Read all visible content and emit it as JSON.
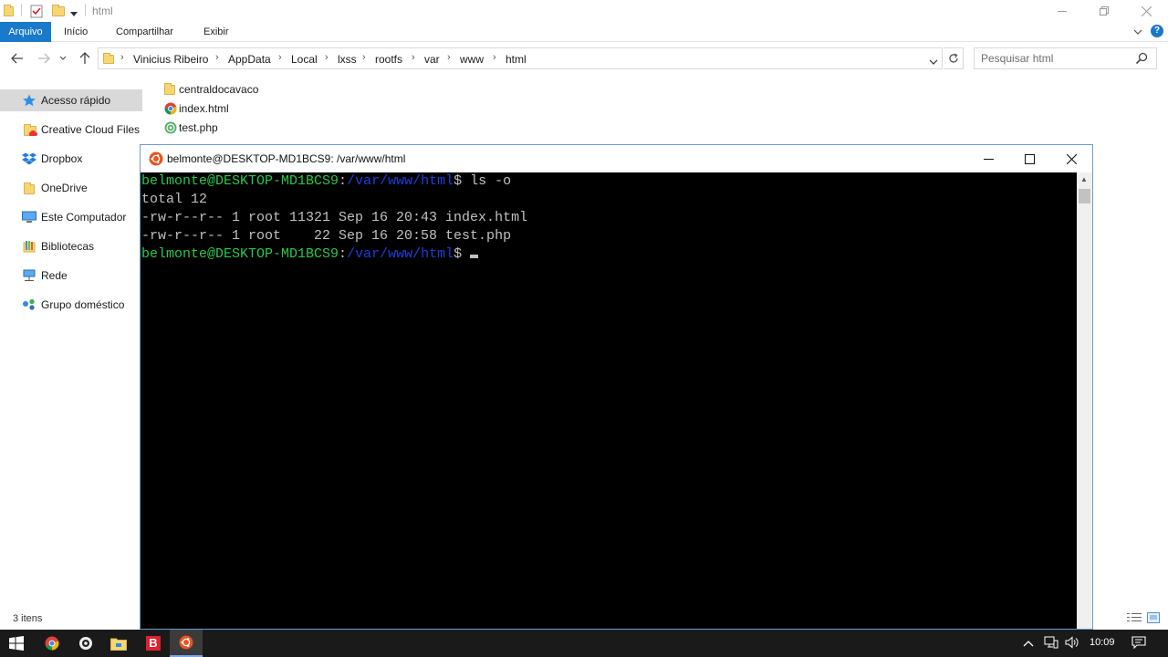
{
  "window": {
    "title": "html",
    "minimize_icon": "minimize-icon",
    "maximize_icon": "restore-icon",
    "close_icon": "close-icon"
  },
  "ribbon": {
    "tabs": [
      {
        "label": "Arquivo"
      },
      {
        "label": "Início"
      },
      {
        "label": "Compartilhar"
      },
      {
        "label": "Exibir"
      }
    ]
  },
  "address": {
    "breadcrumb": [
      "Vinicius Ribeiro",
      "AppData",
      "Local",
      "lxss",
      "rootfs",
      "var",
      "www",
      "html"
    ],
    "search_placeholder": "Pesquisar html"
  },
  "navpane": {
    "items": [
      {
        "label": "Acesso rápido",
        "icon": "star-icon",
        "selected": true
      },
      {
        "label": "Creative Cloud Files",
        "icon": "creative-cloud-folder-icon"
      },
      {
        "label": "Dropbox",
        "icon": "dropbox-icon"
      },
      {
        "label": "OneDrive",
        "icon": "folder-icon"
      },
      {
        "label": "Este Computador",
        "icon": "computer-icon"
      },
      {
        "label": "Bibliotecas",
        "icon": "libraries-icon"
      },
      {
        "label": "Rede",
        "icon": "network-icon"
      },
      {
        "label": "Grupo doméstico",
        "icon": "homegroup-icon"
      }
    ]
  },
  "files": [
    {
      "name": "centraldocavaco",
      "icon": "folder-icon"
    },
    {
      "name": "index.html",
      "icon": "chrome-file-icon"
    },
    {
      "name": "test.php",
      "icon": "php-file-icon"
    }
  ],
  "status": {
    "item_count": "3 itens"
  },
  "terminal": {
    "title": "belmonte@DESKTOP-MD1BCS9: /var/www/html",
    "prompt_user": "belmonte@DESKTOP-MD1BCS9",
    "prompt_sep": ":",
    "prompt_path": "/var/www/html",
    "prompt_end": "$ ",
    "command": "ls -o",
    "output": [
      "total 12",
      "-rw-r--r-- 1 root 11321 Sep 16 20:43 index.html",
      "-rw-r--r-- 1 root    22 Sep 16 20:58 test.php"
    ]
  },
  "taskbar": {
    "clock": "10:09",
    "apps": [
      "chrome-icon",
      "app-icon",
      "file-explorer-icon",
      "b-app-icon",
      "ubuntu-icon"
    ],
    "active_app": "ubuntu-icon"
  },
  "colors": {
    "accent": "#1979ca",
    "terminal_user": "#26c94a",
    "terminal_path": "#1a3fe0",
    "terminal_text": "#c0c0c0",
    "ubuntu_orange": "#e95420"
  }
}
